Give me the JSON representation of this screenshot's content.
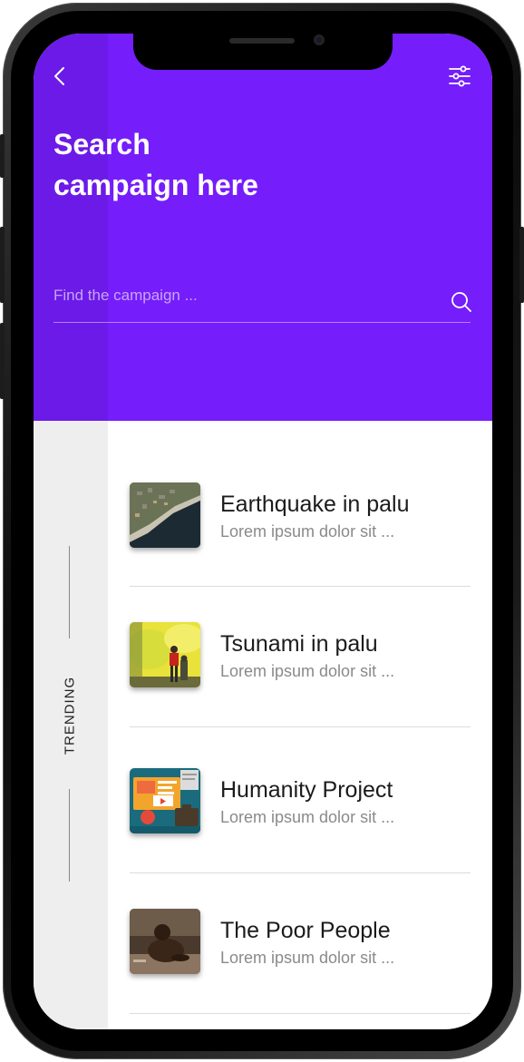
{
  "header": {
    "title_line1": "Search",
    "title_line2": "campaign here",
    "accent_color": "#751dfa"
  },
  "search": {
    "placeholder": "Find the campaign ..."
  },
  "sidebar": {
    "label": "TRENDING"
  },
  "campaigns": [
    {
      "title": "Earthquake in palu",
      "subtitle": "Lorem ipsum dolor sit ...",
      "image": "aerial-coast-image"
    },
    {
      "title": "Tsunami in palu",
      "subtitle": "Lorem ipsum dolor sit ...",
      "image": "rescue-smoke-image"
    },
    {
      "title": "Humanity Project",
      "subtitle": "Lorem ipsum dolor sit ...",
      "image": "illustration-image"
    },
    {
      "title": "The Poor People",
      "subtitle": "Lorem ipsum dolor sit ...",
      "image": "child-portrait-image"
    }
  ],
  "icons": {
    "back": "chevron-left-icon",
    "filter": "sliders-icon",
    "search": "search-icon"
  }
}
